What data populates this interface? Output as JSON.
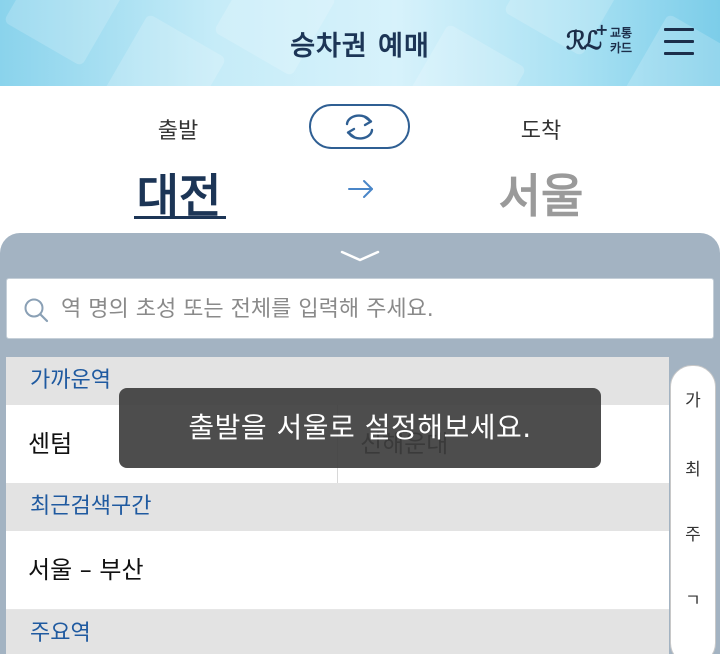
{
  "header": {
    "title": "승차권 예매",
    "card_logo": "ℛℒ",
    "card_plus": "+",
    "card_line1": "교통",
    "card_line2": "카드",
    "menu_icon": "hamburger-menu-icon"
  },
  "route": {
    "departure_label": "출발",
    "arrival_label": "도착",
    "departure_station": "대전",
    "arrival_station": "서울",
    "swap_icon": "swap-icon",
    "arrow_icon": "arrow-right-icon"
  },
  "search": {
    "placeholder": "역 명의 초성 또는 전체를 입력해 주세요.",
    "value": ""
  },
  "sections": [
    {
      "header": "가까운역",
      "rows": [
        [
          "센텀",
          "신해운대"
        ]
      ]
    },
    {
      "header": "최근검색구간",
      "rows": [
        [
          "서울 – 부산"
        ]
      ]
    },
    {
      "header": "주요역",
      "rows": []
    }
  ],
  "index_bar": [
    "가",
    "최",
    "주",
    "ㄱ"
  ],
  "toast": "출발을 서울로 설정해보세요.",
  "colors": {
    "primary": "#1c3556",
    "accent": "#1f5aa0",
    "sheet": "#a3b3c2",
    "toast_bg": "#3e3e3e"
  }
}
